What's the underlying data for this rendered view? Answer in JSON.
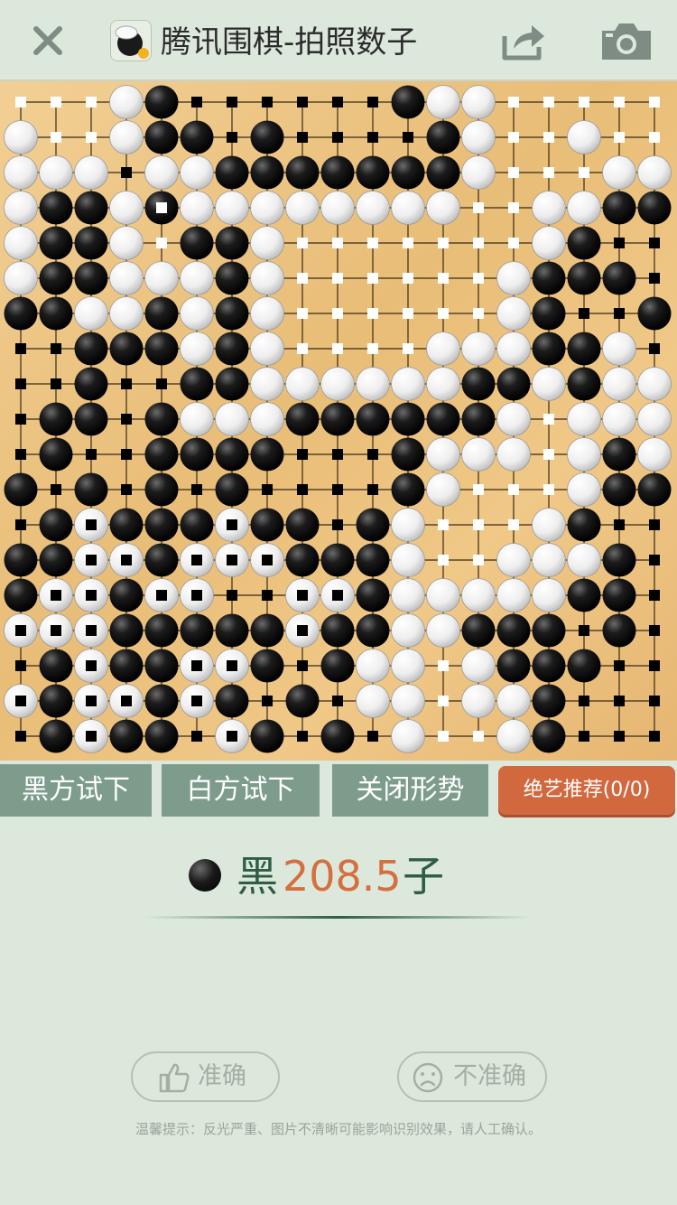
{
  "header": {
    "title": "腾讯围棋-拍照数子",
    "close_icon": "close-icon",
    "logo_icon": "go-app-logo-icon",
    "share_icon": "share-icon",
    "camera_icon": "camera-icon"
  },
  "board": {
    "size": 19,
    "legend": {
      "B": "black stone",
      "W": "white stone",
      "b": "black territory mark",
      "w": "white territory mark",
      "X": "black stone counted dead (white territory)",
      "Y": "white stone counted dead (black territory)"
    },
    "rows": [
      "wwwWBbbbbbbBWWwwwww",
      "WwwWBBbBbbbbBWwwWww",
      "WWWbWWBBBBBBBWwwwWW",
      "WBBWXWWWWWWWWwwWWBB",
      "WBBWwBBWwwwwwwwWBbb",
      "WBBWWWBWwwwwwwWBBBb",
      "BBWWBWBWwwwwwwWBbbB",
      "bbBBBWBWwwwwWWWBBWb",
      "bbBbbBBWWWWWWBBWBWW",
      "bBBbBWWWBBBBBBWwWWW",
      "bBbbBBBBbbbBWWWwWBW",
      "BbBbBbBbbbbBWwwwWBBB",
      "bBYBBBYBBbBWwwwWBbb",
      "BBYYBYYYBBBWwwWWWBb",
      "BYYBYYbbYYBWWWWWBBb",
      "YYYBBBBBYBBWWBBBbBb",
      "bBYBBYYBbBWWwWBBBbb",
      "YBYYBYBbBbWWwWWBbbb",
      "bBYBBbYBbBbWwwWBbbb"
    ]
  },
  "buttons": {
    "black_try": "黑方试下",
    "white_try": "白方试下",
    "close_status": "关闭形势",
    "jueyi_recommend": "绝艺推荐(0/0)"
  },
  "score": {
    "side": "黑",
    "value": "208.5",
    "unit": "子"
  },
  "feedback": {
    "accurate": "准确",
    "inaccurate": "不准确",
    "accurate_icon": "thumbs-up-icon",
    "inaccurate_icon": "sad-face-icon"
  },
  "hint": "温馨提示：反光严重、图片不清晰可能影响识别效果，请人工确认。",
  "colors": {
    "background": "#dde8dd",
    "button_green": "#7d9c8c",
    "button_orange": "#d2683d",
    "score_value": "#d46f3e",
    "score_text": "#2e5d43"
  }
}
